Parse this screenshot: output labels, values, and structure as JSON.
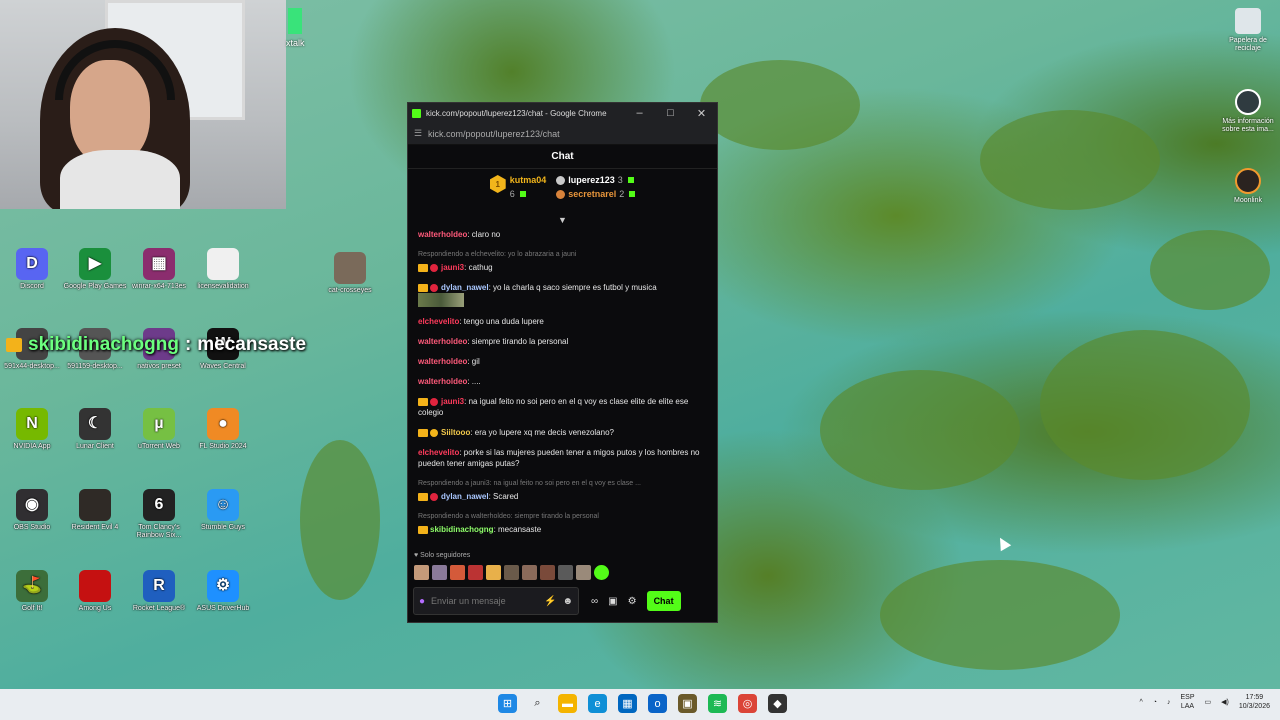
{
  "webcam": {
    "partial_label": "xtalk"
  },
  "desktop_icons": [
    {
      "label": "Discord",
      "icon": "discord-icon",
      "color": "#5865f2",
      "glyph": "D"
    },
    {
      "label": "Google Play Games",
      "icon": "google-play-games-icon",
      "color": "#1a8f3c",
      "glyph": "▶"
    },
    {
      "label": "winrar-x64-713es",
      "icon": "winrar-icon",
      "color": "#8b2d6e",
      "glyph": "▦"
    },
    {
      "label": "licensevalidation",
      "icon": "file-icon",
      "color": "#f0f0f0",
      "glyph": ""
    },
    {
      "label": "cat-crosseyes",
      "icon": "image-icon",
      "color": "#7a6a5a",
      "glyph": ""
    },
    {
      "label": "591x44-desktop...",
      "icon": "shortcut-icon",
      "color": "#444",
      "glyph": ""
    },
    {
      "label": "591159-desktop...",
      "icon": "shortcut-icon",
      "color": "#555",
      "glyph": ""
    },
    {
      "label": "nativos preset",
      "icon": "preset-icon",
      "color": "#6d3b8a",
      "glyph": ""
    },
    {
      "label": "Waves Central",
      "icon": "waves-icon",
      "color": "#111",
      "glyph": "W"
    },
    {
      "label": "NVIDIA App",
      "icon": "nvidia-icon",
      "color": "#76b900",
      "glyph": "N"
    },
    {
      "label": "Lunar Client",
      "icon": "lunar-client-icon",
      "color": "#333",
      "glyph": "☾"
    },
    {
      "label": "uTorrent Web",
      "icon": "utorrent-icon",
      "color": "#76c043",
      "glyph": "µ"
    },
    {
      "label": "FL Studio 2024",
      "icon": "fl-studio-icon",
      "color": "#f08a24",
      "glyph": "●"
    },
    {
      "label": "OBS Studio",
      "icon": "obs-icon",
      "color": "#302e31",
      "glyph": "◉"
    },
    {
      "label": "Resident Evil 4",
      "icon": "resident-evil-icon",
      "color": "#2f2a26",
      "glyph": ""
    },
    {
      "label": "Tom Clancy's Rainbow Six...",
      "icon": "rainbow-six-icon",
      "color": "#222",
      "glyph": "6"
    },
    {
      "label": "Stumble Guys",
      "icon": "stumble-guys-icon",
      "color": "#2a9af3",
      "glyph": "☺"
    },
    {
      "label": "Golf It!",
      "icon": "golf-it-icon",
      "color": "#3c6e3a",
      "glyph": "⛳"
    },
    {
      "label": "Among Us",
      "icon": "among-us-icon",
      "color": "#c51111",
      "glyph": ""
    },
    {
      "label": "Rocket League®",
      "icon": "rocket-league-icon",
      "color": "#1f5fbf",
      "glyph": "R"
    },
    {
      "label": "ASUS DriverHub",
      "icon": "asus-driverhub-icon",
      "color": "#1e90ff",
      "glyph": "⚙"
    }
  ],
  "overlay": {
    "user": "skibidinachogng",
    "separator": ":",
    "message": "mecansaste"
  },
  "right_icons": [
    {
      "label": "Papelera de reciclaje",
      "icon": "recycle-bin-icon"
    },
    {
      "label": "Más información sobre esta ima...",
      "icon": "info-icon"
    },
    {
      "label": "Moonlink",
      "icon": "moonlink-icon"
    }
  ],
  "chrome": {
    "title": "kick.com/popout/luperez123/chat - Google Chrome",
    "url": "kick.com/popout/luperez123/chat",
    "minimize": "–",
    "maximize": "□",
    "close": "✕"
  },
  "chat": {
    "header": "Chat",
    "leaderboard": {
      "first": {
        "rank": "1",
        "name": "kutma04",
        "count": "6"
      },
      "second": {
        "name": "luperez123",
        "count": "3"
      },
      "third": {
        "name": "secretnarel",
        "count": "2"
      }
    },
    "messages": [
      {
        "reply": "",
        "user": "walterholdeo",
        "color": "u-pink",
        "badges": [],
        "text": ": claro no"
      },
      {
        "reply": "Respondiendo a elchevelito: yo lo abrazaria a jauni",
        "user": "jauni3",
        "color": "u-red",
        "badges": [
          "crown",
          "red"
        ],
        "text": ": cathug"
      },
      {
        "reply": "",
        "user": "dylan_nawel",
        "color": "u-blue",
        "badges": [
          "crown",
          "red"
        ],
        "text": ": yo la charla q saco siempre es futbol y musica",
        "emote": true
      },
      {
        "reply": "",
        "user": "elchevelito",
        "color": "u-red",
        "badges": [],
        "text": ": tengo una duda lupere"
      },
      {
        "reply": "",
        "user": "walterholdeo",
        "color": "u-pink",
        "badges": [],
        "text": ": siempre tirando la personal"
      },
      {
        "reply": "",
        "user": "walterholdeo",
        "color": "u-pink",
        "badges": [],
        "text": ": gil"
      },
      {
        "reply": "",
        "user": "walterholdeo",
        "color": "u-pink",
        "badges": [],
        "text": ": ...."
      },
      {
        "reply": "",
        "user": "jauni3",
        "color": "u-red",
        "badges": [
          "crown",
          "red"
        ],
        "text": ": na igual feito no soi pero en el q voy es clase elite de elite ese colegio"
      },
      {
        "reply": "",
        "user": "Siiltooo",
        "color": "u-yellow",
        "badges": [
          "crown",
          "gold"
        ],
        "text": ": era yo lupere xq me decis venezolano?"
      },
      {
        "reply": "",
        "user": "elchevelito",
        "color": "u-red",
        "badges": [],
        "text": ": porke si las mujeres pueden tener a migos putos y los hombres no pueden tener amigas putas?"
      },
      {
        "reply": "Respondiendo a jauni3: na igual feito no soi pero en el q voy es clase ...",
        "user": "dylan_nawel",
        "color": "u-blue",
        "badges": [
          "crown",
          "red"
        ],
        "text": ": Scared"
      },
      {
        "reply": "Respondiendo a walterholdeo: siempre tirando la personal",
        "user": "skibidinachogng",
        "color": "u-green",
        "badges": [
          "crown"
        ],
        "text": ": mecansaste"
      }
    ],
    "followers_only": "Solo seguidores",
    "emote_colors": [
      "#c49a7a",
      "#8a7a9a",
      "#d45a3a",
      "#b33",
      "#e8b04a",
      "#6a5a4a",
      "#8a6a5a",
      "#7a4a3a",
      "#5a5a5a",
      "#9a8a7a",
      "#53fc18"
    ],
    "input_placeholder": "Enviar un mensaje",
    "send_label": "Chat"
  },
  "taskbar": {
    "apps": [
      {
        "icon": "windows-start-icon",
        "color": "#1e88e5",
        "glyph": "⊞"
      },
      {
        "icon": "search-icon",
        "color": "#e9edf1",
        "glyph": "⌕"
      },
      {
        "icon": "file-explorer-icon",
        "color": "#f4b400",
        "glyph": "▬"
      },
      {
        "icon": "edge-icon",
        "color": "#0f8fd6",
        "glyph": "e"
      },
      {
        "icon": "calculator-icon",
        "color": "#0067c0",
        "glyph": "▦"
      },
      {
        "icon": "outlook-icon",
        "color": "#0a64c8",
        "glyph": "o"
      },
      {
        "icon": "game-icon",
        "color": "#6b5a2a",
        "glyph": "▣"
      },
      {
        "icon": "spotify-icon",
        "color": "#1db954",
        "glyph": "≋"
      },
      {
        "icon": "chrome-icon",
        "color": "#db4437",
        "glyph": "◎"
      },
      {
        "icon": "roblox-icon",
        "color": "#333",
        "glyph": "◆"
      }
    ],
    "lang_top": "ESP",
    "lang_bottom": "LAA",
    "time": "17:59",
    "date": "10/3/2026"
  }
}
